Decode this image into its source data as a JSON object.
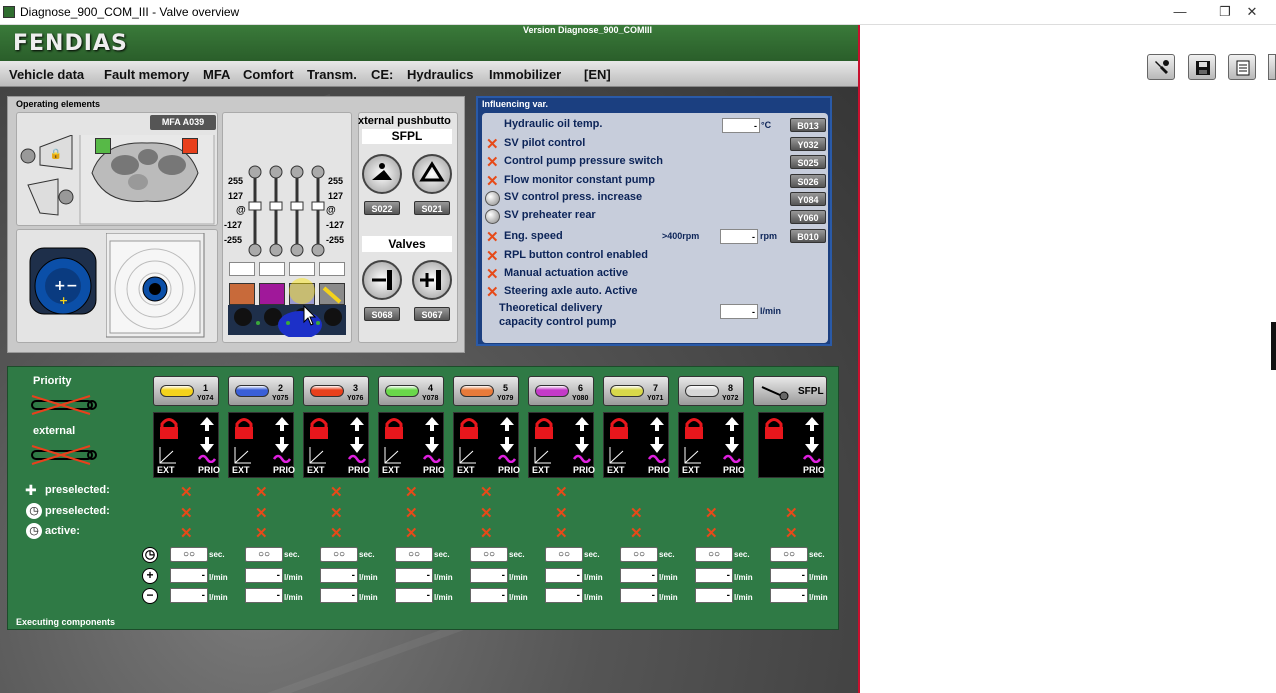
{
  "window": {
    "title": "Diagnose_900_COM_III - Valve overview"
  },
  "header": {
    "logo": "FENDIAS",
    "version": "Version Diagnose_900_COMIII"
  },
  "menu": [
    "Vehicle data",
    "Fault memory",
    "MFA",
    "Comfort",
    "Transm.",
    "CE:",
    "Hydraulics",
    "Immobilizer",
    "[EN]"
  ],
  "operating": {
    "title": "Operating elements",
    "mfa_label": "MFA A039",
    "ext_title": "xternal pushbutto",
    "sfpl": "SFPL",
    "sfpl_codes": [
      "S022",
      "S021"
    ],
    "valves_title": "Valves",
    "valve_codes": [
      "S068",
      "S067"
    ],
    "scale_left": [
      "255",
      "127",
      "@",
      "-127",
      "-255"
    ],
    "scale_right": [
      "255",
      "127",
      "@",
      "-127",
      "-255"
    ],
    "slider_values": [
      "",
      "",
      "",
      ""
    ],
    "colors": {
      "green": "#57b947",
      "red": "#e8401c",
      "c1": "#c86a3a",
      "c2": "#a0189a",
      "c3": "#9a9ad0",
      "c4": "#c8b040"
    }
  },
  "influencing": {
    "title": "Influencing var.",
    "rows": [
      {
        "label": "Hydraulic oil temp.",
        "mark": "none",
        "value": "-",
        "unit": "°C",
        "code": "B013"
      },
      {
        "label": "SV pilot control",
        "mark": "x",
        "code": "Y032"
      },
      {
        "label": "Control pump pressure switch",
        "mark": "x",
        "code": "S025"
      },
      {
        "label": "Flow monitor constant pump",
        "mark": "x",
        "code": "S026"
      },
      {
        "label": "SV control press. increase",
        "mark": "circle",
        "code": "Y084"
      },
      {
        "label": "SV preheater rear",
        "mark": "circle",
        "code": "Y060"
      },
      {
        "label": "Eng. speed",
        "mark": "x",
        "extra": ">400rpm",
        "value": "-",
        "unit": "rpm",
        "code": "B010"
      },
      {
        "label": "RPL button control enabled",
        "mark": "x"
      },
      {
        "label": "Manual actuation active",
        "mark": "x"
      },
      {
        "label": "Steering axle auto. Active",
        "mark": "x"
      }
    ],
    "delivery_label_1": "Theoretical delivery",
    "delivery_label_2": "capacity control pump",
    "delivery_value": "-",
    "delivery_unit": "l/min"
  },
  "executing": {
    "title": "Executing components",
    "priority_label": "Priority",
    "external_label": "external",
    "preselected_1": "preselected:",
    "preselected_2": "preselected:",
    "active": "active:",
    "ext_text": "EXT",
    "prio_text": "PRIO",
    "sec_unit": "sec.",
    "flow_unit": "l/min",
    "sec_value": "○○",
    "flow_value": "-",
    "valves": [
      {
        "num": "1",
        "code": "Y074",
        "color": "#f4d21c"
      },
      {
        "num": "2",
        "code": "Y075",
        "color": "#3a5fd8"
      },
      {
        "num": "3",
        "code": "Y076",
        "color": "#e8401c"
      },
      {
        "num": "4",
        "code": "Y078",
        "color": "#6ad84a"
      },
      {
        "num": "5",
        "code": "Y079",
        "color": "#e87a3a"
      },
      {
        "num": "6",
        "code": "Y080",
        "color": "#c43ac8"
      },
      {
        "num": "7",
        "code": "Y071",
        "color": "#d8d84a"
      },
      {
        "num": "8",
        "code": "Y072",
        "color": "#d8d8d8"
      }
    ],
    "sfpl_label": "SFPL"
  }
}
